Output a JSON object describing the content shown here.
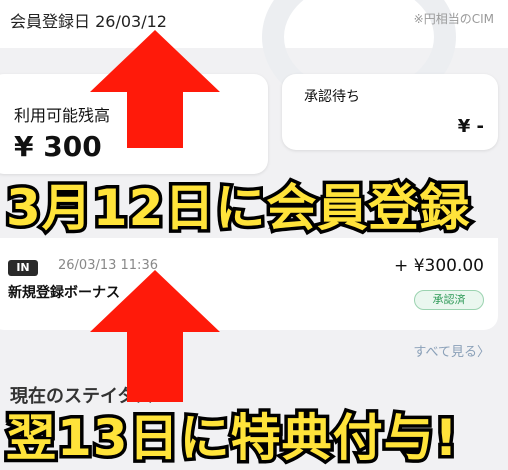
{
  "header": {
    "registration_date": "会員登録日 26/03/12",
    "currency_note": "※円相当のCIM"
  },
  "balance_card": {
    "label": "利用可能残高",
    "value": "¥ 300"
  },
  "pending_card": {
    "label": "承認待ち",
    "value": "¥ -"
  },
  "transaction": {
    "tag": "IN",
    "datetime": "26/03/13 11:36",
    "amount": "+ ¥300.00",
    "title": "新規登録ボーナス",
    "status": "承認済"
  },
  "links": {
    "see_all": "すべて見る〉"
  },
  "sections": {
    "current_status": "現在のステイタス"
  },
  "captions": {
    "top": "3月12日に会員登録",
    "bottom": "翌13日に特典付与!"
  },
  "colors": {
    "arrow": "#ff1a0a",
    "caption_fill": "#ffe33a",
    "caption_stroke": "#000000",
    "approved_green": "#2f9a58"
  }
}
